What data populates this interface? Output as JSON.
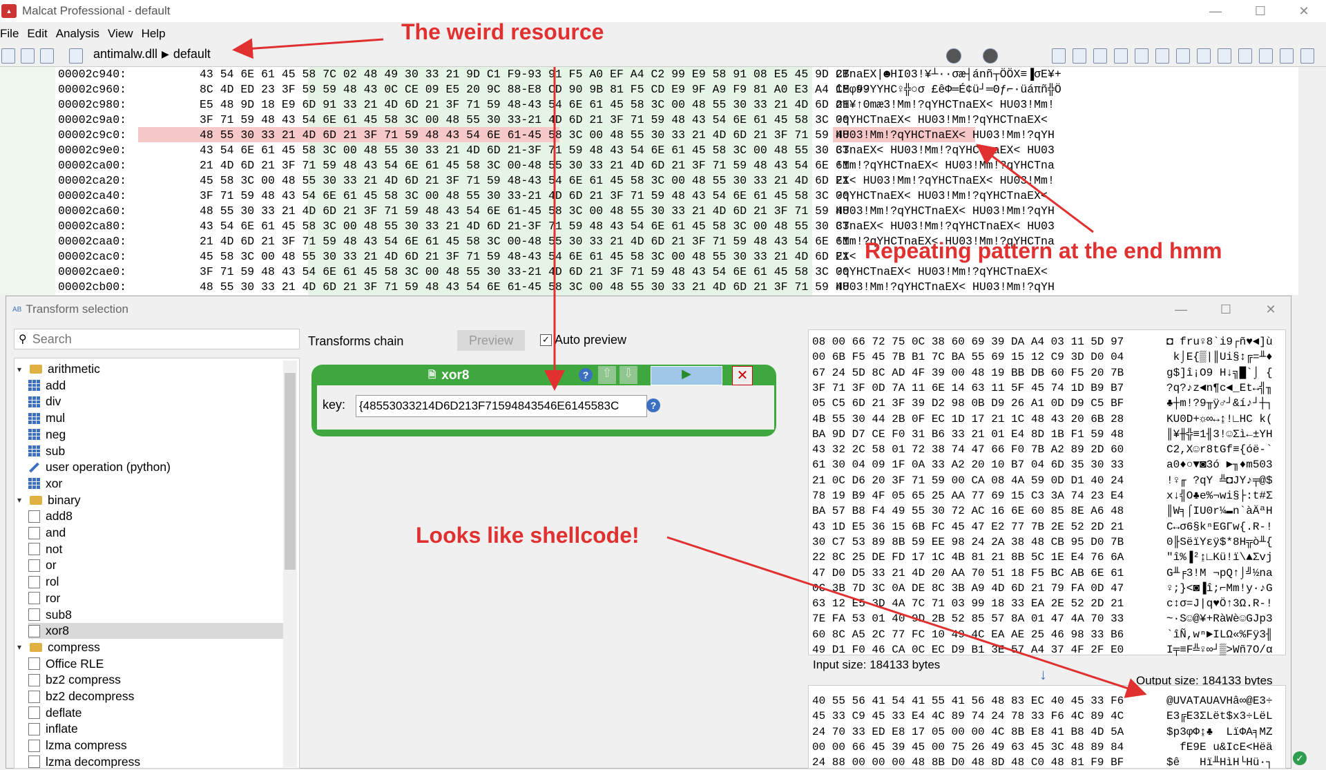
{
  "window": {
    "title": "Malcat Professional - default",
    "minimize": "—",
    "maximize": "☐",
    "close": "✕",
    "app_icon": "malcat"
  },
  "menu": [
    "File",
    "Edit",
    "Analysis",
    "View",
    "Help"
  ],
  "breadcrumb": {
    "file": "antimalw.dll",
    "sep": "▶",
    "page": "default"
  },
  "hexview": {
    "rows": [
      {
        "addr": "00002c940:",
        "hex": "43 54 6E 61 45 58 7C 02 48 49 30 33 21 9D C1 F9-93 91 F5 A0 EF A4 C2 99 E9 58 91 08 E5 45 9D 2B",
        "ascii": "CTnaEX|☻HI03!¥┴·∙σæ┤ánñ┬ÖÖX≡▐σE¥+"
      },
      {
        "addr": "00002c960:",
        "hex": "8C 4D ED 23 3F 59 59 48 43 0C CE 09 E5 20 9C 88-E8 CD 90 9B 81 F5 CD E9 9F A9 F9 81 A0 E3 A4 CE 99",
        "ascii": "îMφ#?YYHC♀╬○σ £êΦ═É¢ü┘═Θƒ⌐·üáπñ╬Ö"
      },
      {
        "addr": "00002c980:",
        "hex": "E5 48 9D 18 E9 6D 91 33 21 4D 6D 21 3F 71 59 48-43 54 6E 61 45 58 3C 00 48 55 30 33 21 4D 6D 21",
        "ascii": "σH¥↑Θmæ3!Mm!?qYHCTnaEX< HU03!Mm!"
      },
      {
        "addr": "00002c9a0:",
        "hex": "3F 71 59 48 43 54 6E 61 45 58 3C 00 48 55 30 33-21 4D 6D 21 3F 71 59 48 43 54 6E 61 45 58 3C 00",
        "ascii": "?qYHCTnaEX< HU03!Mm!?qYHCTnaEX<"
      },
      {
        "addr": "00002c9c0:",
        "hex": "48 55 30 33 21 4D 6D 21 3F 71 59 48 43 54 6E 61-45 58 3C 00 48 55 30 33 21 4D 6D 21 3F 71 59 48",
        "ascii": "HU03!Mm!?qYHCTnaEX< HU03!Mm!?qYH"
      },
      {
        "addr": "00002c9e0:",
        "hex": "43 54 6E 61 45 58 3C 00 48 55 30 33 21 4D 6D 21-3F 71 59 48 43 54 6E 61 45 58 3C 00 48 55 30 33",
        "ascii": "CTnaEX< HU03!Mm!?qYHCTnaEX< HU03"
      },
      {
        "addr": "00002ca00:",
        "hex": "21 4D 6D 21 3F 71 59 48 43 54 6E 61 45 58 3C 00-48 55 30 33 21 4D 6D 21 3F 71 59 48 43 54 6E 61",
        "ascii": "!Mm!?qYHCTnaEX< HU03!Mm!?qYHCTna"
      },
      {
        "addr": "00002ca20:",
        "hex": "45 58 3C 00 48 55 30 33 21 4D 6D 21 3F 71 59 48-43 54 6E 61 45 58 3C 00 48 55 30 33 21 4D 6D 21",
        "ascii": "EX< HU03!Mm!?qYHCTnaEX< HU03!Mm!"
      },
      {
        "addr": "00002ca40:",
        "hex": "3F 71 59 48 43 54 6E 61 45 58 3C 00 48 55 30 33-21 4D 6D 21 3F 71 59 48 43 54 6E 61 45 58 3C 00",
        "ascii": "?qYHCTnaEX< HU03!Mm!?qYHCTnaEX<"
      },
      {
        "addr": "00002ca60:",
        "hex": "48 55 30 33 21 4D 6D 21 3F 71 59 48 43 54 6E 61-45 58 3C 00 48 55 30 33 21 4D 6D 21 3F 71 59 48",
        "ascii": "HU03!Mm!?qYHCTnaEX< HU03!Mm!?qYH"
      },
      {
        "addr": "00002ca80:",
        "hex": "43 54 6E 61 45 58 3C 00 48 55 30 33 21 4D 6D 21-3F 71 59 48 43 54 6E 61 45 58 3C 00 48 55 30 33",
        "ascii": "CTnaEX< HU03!Mm!?qYHCTnaEX< HU03"
      },
      {
        "addr": "00002caa0:",
        "hex": "21 4D 6D 21 3F 71 59 48 43 54 6E 61 45 58 3C 00-48 55 30 33 21 4D 6D 21 3F 71 59 48 43 54 6E 61",
        "ascii": "!Mm!?qYHCTnaEX< HU03!Mm!?qYHCTna"
      },
      {
        "addr": "00002cac0:",
        "hex": "45 58 3C 00 48 55 30 33 21 4D 6D 21 3F 71 59 48-43 54 6E 61 45 58 3C 00 48 55 30 33 21 4D 6D 21",
        "ascii": "EX<"
      },
      {
        "addr": "00002cae0:",
        "hex": "3F 71 59 48 43 54 6E 61 45 58 3C 00 48 55 30 33-21 4D 6D 21 3F 71 59 48 43 54 6E 61 45 58 3C 00",
        "ascii": "?qYHCTnaEX< HU03!Mm!?qYHCTnaEX<"
      },
      {
        "addr": "00002cb00:",
        "hex": "48 55 30 33 21 4D 6D 21 3F 71 59 48 43 54 6E 61-45 58 3C 00 48 55 30 33 21 4D 6D 21 3F 71 59 48",
        "ascii": "HU03!Mm!?qYHCTnaEX< HU03!Mm!?qYH"
      }
    ]
  },
  "dialog": {
    "title": "Transform selection",
    "search_placeholder": "Search",
    "chain_label": "Transforms chain",
    "preview_button": "Preview",
    "auto_preview": "Auto preview",
    "auto_preview_checked": "✓",
    "tree": [
      {
        "label": "arithmetic",
        "kind": "folder",
        "level": 0,
        "expanded": "▾"
      },
      {
        "label": "add",
        "kind": "grid",
        "level": 1
      },
      {
        "label": "div",
        "kind": "grid",
        "level": 1
      },
      {
        "label": "mul",
        "kind": "grid",
        "level": 1
      },
      {
        "label": "neg",
        "kind": "grid",
        "level": 1
      },
      {
        "label": "sub",
        "kind": "grid",
        "level": 1
      },
      {
        "label": "user operation (python)",
        "kind": "pencil",
        "level": 1
      },
      {
        "label": "xor",
        "kind": "grid",
        "level": 1
      },
      {
        "label": "binary",
        "kind": "folder",
        "level": 0,
        "expanded": "▾"
      },
      {
        "label": "add8",
        "kind": "bin",
        "level": 1
      },
      {
        "label": "and",
        "kind": "bin",
        "level": 1
      },
      {
        "label": "not",
        "kind": "bin",
        "level": 1
      },
      {
        "label": "or",
        "kind": "bin",
        "level": 1
      },
      {
        "label": "rol",
        "kind": "bin",
        "level": 1
      },
      {
        "label": "ror",
        "kind": "bin",
        "level": 1
      },
      {
        "label": "sub8",
        "kind": "bin",
        "level": 1
      },
      {
        "label": "xor8",
        "kind": "bin",
        "level": 1,
        "selected": true
      },
      {
        "label": "compress",
        "kind": "folder",
        "level": 0,
        "expanded": "▾"
      },
      {
        "label": "Office RLE",
        "kind": "doc",
        "level": 1
      },
      {
        "label": "bz2 compress",
        "kind": "doc",
        "level": 1
      },
      {
        "label": "bz2 decompress",
        "kind": "doc",
        "level": 1
      },
      {
        "label": "deflate",
        "kind": "doc",
        "level": 1
      },
      {
        "label": "inflate",
        "kind": "doc",
        "level": 1
      },
      {
        "label": "lzma compress",
        "kind": "doc",
        "level": 1
      },
      {
        "label": "lzma decompress",
        "kind": "doc",
        "level": 1
      }
    ],
    "transform": {
      "name": "xor8",
      "key_label": "key:",
      "key_value": "{48553033214D6D213F71594843546E6145583C",
      "help": "?",
      "close": "✕",
      "run": "▶",
      "up": "⇧",
      "down": "⇩"
    },
    "input_rows": [
      {
        "hex": "08 00 66 72 75 0C 38 60 69 39 DA A4 03 11 5D 97",
        "ascii": "◘ fru♀8`i9┌ñ♥◄]ù"
      },
      {
        "hex": "00 6B F5 45 7B B1 7C BA 55 69 15 12 C9 3D D0 04",
        "ascii": " k⌡E{▒|║Ui§↕╔=╨♦"
      },
      {
        "hex": "67 24 5D 8C AD 4F 39 00 48 19 BB DB 60 F5 20 7B",
        "ascii": "g$]î¡O9 H↓╗█`⌡ {"
      },
      {
        "hex": "3F 71 3F 0D 7A 11 6E 14 63 11 5F 45 74 1D B9 B7",
        "ascii": "?q?♪z◄n¶c◄_Et↔╣╖"
      },
      {
        "hex": "05 C5 6D 21 3F 39 D2 98 0B D9 26 A1 0D D9 C5 BF",
        "ascii": "♣┼m!?9╥ÿ♂┘&í♪┘┼┐"
      },
      {
        "hex": "4B 55 30 44 2B 0F EC 1D 17 21 1C 48 43 20 6B 28",
        "ascii": "KU0D+☼∞↔↨!∟HC k("
      },
      {
        "hex": "BA 9D D7 CE F0 31 B6 33 21 01 E4 8D 1B F1 59 48",
        "ascii": "║¥╫╬≡1╢3!☺Σì←±YH"
      },
      {
        "hex": "43 32 2C 58 01 72 38 74 47 66 F0 7B A2 89 2D 60",
        "ascii": "C2,X☺r8tGf≡{óë-`"
      },
      {
        "hex": "61 30 04 09 1F 0A 33 A2 20 10 B7 04 6D 35 30 33",
        "ascii": "a0♦○▼◙3ó ►╖♦m503"
      },
      {
        "hex": "21 0C D6 20 3F 71 59 00 CA 08 4A 59 0D D1 40 24",
        "ascii": "!♀╓ ?qY ╩◘JY♪╤@$"
      },
      {
        "hex": "78 19 B9 4F 05 65 25 AA 77 69 15 C3 3A 74 23 E4",
        "ascii": "x↓╣O♣e%¬wi§├:t#Σ"
      },
      {
        "hex": "BA 57 B8 F4 49 55 30 72 AC 16 6E 60 85 8E A6 48",
        "ascii": "║W╕⌠IU0r¼▬n`àÄªH"
      },
      {
        "hex": "43 1D E5 36 15 6B FC 45 47 E2 77 7B 2E 52 2D 21",
        "ascii": "C↔σ6§kⁿEGΓw{.R-!"
      },
      {
        "hex": "30 C7 53 89 8B 59 EE 98 24 2A 38 48 CB 95 D0 7B",
        "ascii": "0╟SëïYεÿ$*8H╦ò╨{"
      },
      {
        "hex": "22 8C 25 DE FD 17 1C 4B 81 21 8B 5C 1E E4 76 6A",
        "ascii": "\"î%▐²↨∟Kü!ï\\▲Σvj"
      },
      {
        "hex": "47 D0 D5 33 21 4D 20 AA 70 51 18 F5 BC AB 6E 61",
        "ascii": "G╨╒3!M ¬pQ↑⌡╝½na"
      },
      {
        "hex": "0C 3B 7D 3C 0A DE 8C 3B A9 4D 6D 21 79 FA 0D 47",
        "ascii": "♀;}<◙▐î;⌐Mm!y·♪G"
      },
      {
        "hex": "63 12 E5 3D 4A 7C 71 03 99 18 33 EA 2E 52 2D 21",
        "ascii": "c↕σ=J|q♥Ö↑3Ω.R-!"
      },
      {
        "hex": "7E FA 53 01 40 9D 2B 52 85 57 8A 01 47 4A 70 33",
        "ascii": "~·S☺@¥+RàWè☺GJp3"
      },
      {
        "hex": "60 8C A5 2C 77 FC 10 49 4C EA AE 25 46 98 33 B6",
        "ascii": "`îÑ,wⁿ►ILΩ«%Fÿ3╢"
      },
      {
        "hex": "49 D1 F0 46 CA 0C EC D9 B1 3E 57 A4 37 4F 2F E0",
        "ascii": "I╤≡F╩♀∞┘▒>Wñ7O/α"
      }
    ],
    "input_size": "Input size: 184133 bytes",
    "output_size": "Output size: 184133 bytes",
    "flow_arrow": "↓",
    "output_rows": [
      {
        "hex": "40 55 56 41 54 41 55 41 56 48 83 EC 40 45 33 F6",
        "ascii": "@UVATAUAVHâ∞@E3÷"
      },
      {
        "hex": "45 33 C9 45 33 E4 4C 89 74 24 78 33 F6 4C 89 4C",
        "ascii": "E3╔E3ΣLët$x3÷LëL"
      },
      {
        "hex": "24 70 33 ED E8 17 05 00 00 4C 8B E8 41 B8 4D 5A",
        "ascii": "$p3φΦ↨♣  LïΦA╕MZ"
      },
      {
        "hex": "00 00 66 45 39 45 00 75 26 49 63 45 3C 48 89 84",
        "ascii": "  fE9E u&IcE<Hëä"
      },
      {
        "hex": "24 88 00 00 00 48 8B D0 48 8D 48 C0 48 81 F9 BF",
        "ascii": "$ê   Hï╨HìH└Hü∙┐"
      }
    ]
  },
  "annotations": {
    "weird_resource": "The weird resource",
    "repeating": "Repeating pattern at the end hmm",
    "shellcode": "Looks like shellcode!"
  },
  "colors": {
    "annotation": "#e03030",
    "transform_green": "#3ea83e",
    "highlight": "#f7c8c8",
    "hex_green": "#e6f4e6"
  }
}
